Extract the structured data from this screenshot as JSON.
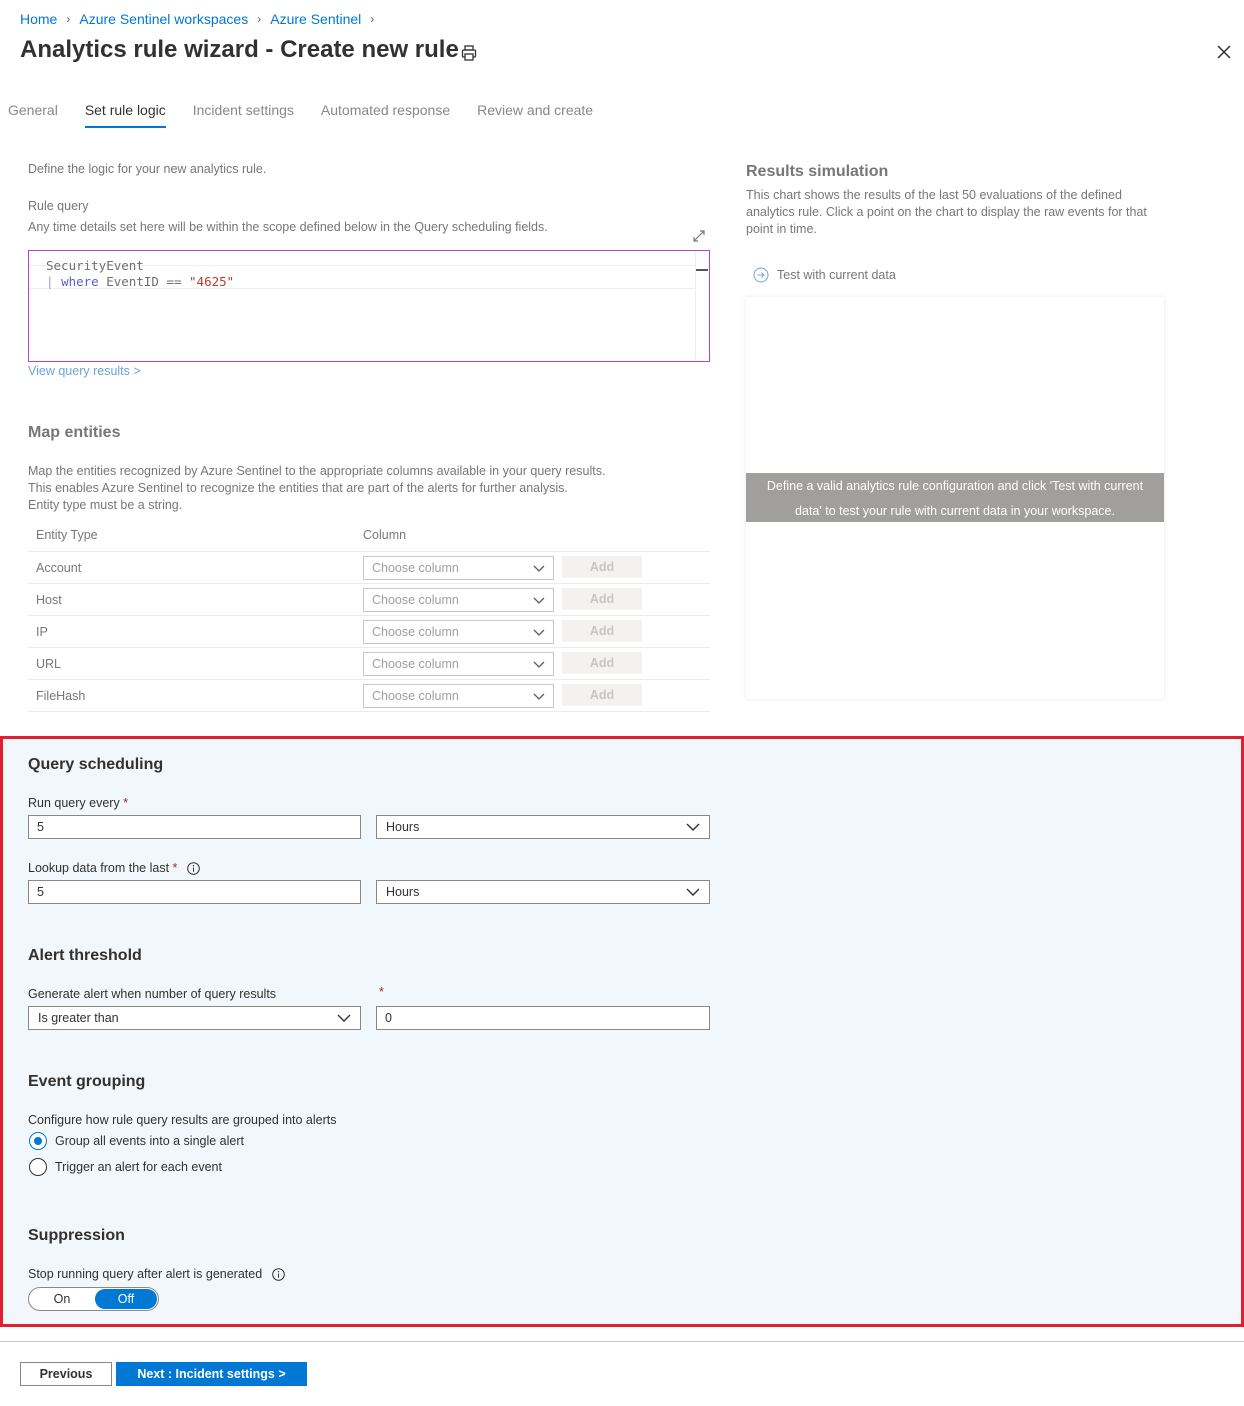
{
  "breadcrumb": [
    "Home",
    "Azure Sentinel workspaces",
    "Azure Sentinel"
  ],
  "title": "Analytics rule wizard - Create new rule",
  "tabs": [
    "General",
    "Set rule logic",
    "Incident settings",
    "Automated response",
    "Review and create"
  ],
  "active_tab": "Set rule logic",
  "intro": "Define the logic for your new analytics rule.",
  "rule_query": {
    "label": "Rule query",
    "hint": "Any time details set here will be within the scope defined below in the Query scheduling fields.",
    "line1": "SecurityEvent",
    "line2_pipe": "|",
    "line2_kw": "where",
    "line2_mid": "EventID ==",
    "line2_str": "\"4625\"",
    "view_results": "View query results >"
  },
  "map_entities": {
    "heading": "Map entities",
    "desc1": "Map the entities recognized by Azure Sentinel to the appropriate columns available in your query results.",
    "desc2": "This enables Azure Sentinel to recognize the entities that are part of the alerts for further analysis.",
    "desc3": "Entity type must be a string.",
    "col_entity": "Entity Type",
    "col_column": "Column",
    "rows": [
      {
        "type": "Account",
        "placeholder": "Choose column",
        "add": "Add"
      },
      {
        "type": "Host",
        "placeholder": "Choose column",
        "add": "Add"
      },
      {
        "type": "IP",
        "placeholder": "Choose column",
        "add": "Add"
      },
      {
        "type": "URL",
        "placeholder": "Choose column",
        "add": "Add"
      },
      {
        "type": "FileHash",
        "placeholder": "Choose column",
        "add": "Add"
      }
    ]
  },
  "results_simulation": {
    "heading": "Results simulation",
    "desc1": "This chart shows the results of the last 50 evaluations of the defined",
    "desc2": "analytics rule. Click a point on the chart to display the raw events for that",
    "desc3": "point in time.",
    "test_button": "Test with current data",
    "banner1": "Define a valid analytics rule configuration and click 'Test with current",
    "banner2": "data' to test your rule with current data in your workspace."
  },
  "query_scheduling": {
    "heading": "Query scheduling",
    "run_every_label": "Run query every",
    "run_every_value": "5",
    "run_every_unit": "Hours",
    "lookup_label": "Lookup data from the last",
    "lookup_value": "5",
    "lookup_unit": "Hours",
    "required_mark": "*"
  },
  "alert_threshold": {
    "heading": "Alert threshold",
    "label": "Generate alert when number of query results",
    "operator": "Is greater than",
    "value": "0"
  },
  "event_grouping": {
    "heading": "Event grouping",
    "label": "Configure how rule query results are grouped into alerts",
    "option1": "Group all events into a single alert",
    "option2": "Trigger an alert for each event",
    "selected": "option1"
  },
  "suppression": {
    "heading": "Suppression",
    "label": "Stop running query after alert is generated",
    "on": "On",
    "off": "Off",
    "selected": "Off"
  },
  "footer": {
    "previous": "Previous",
    "next": "Next : Incident settings >"
  },
  "colors": {
    "accent": "#0078d4",
    "highlight_border": "#e0202e",
    "scheduling_bg": "#f1f7fb"
  }
}
